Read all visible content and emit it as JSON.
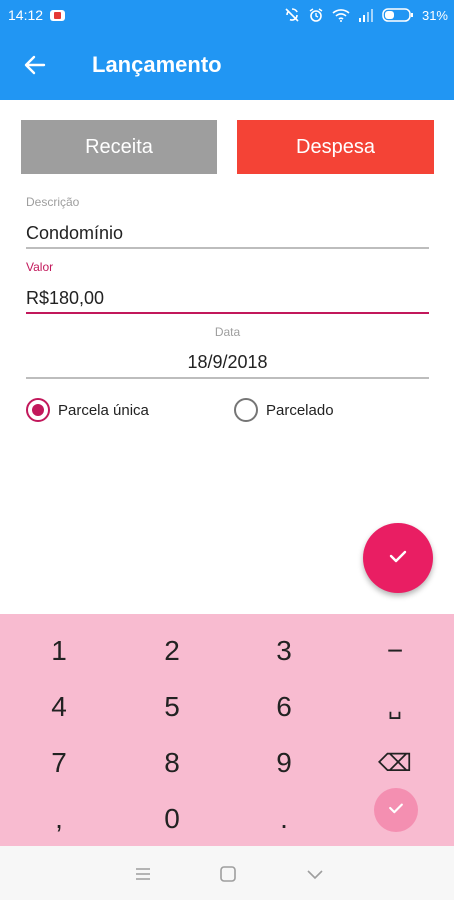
{
  "status_bar": {
    "time": "14:12",
    "battery": "31%"
  },
  "app_bar": {
    "title": "Lançamento"
  },
  "type_buttons": {
    "receita": "Receita",
    "despesa": "Despesa"
  },
  "form": {
    "descricao_label": "Descrição",
    "descricao_value": "Condomínio",
    "valor_label": "Valor",
    "valor_value": "R$180,00",
    "data_label": "Data",
    "data_value": "18/9/2018"
  },
  "radio": {
    "unica_label": "Parcela única",
    "parcelado_label": "Parcelado",
    "selected": "Parcela única"
  },
  "keypad": {
    "row1": [
      "1",
      "2",
      "3",
      "−"
    ],
    "row2": [
      "4",
      "5",
      "6",
      "␣"
    ],
    "row3": [
      "7",
      "8",
      "9",
      "⌫"
    ],
    "row4": [
      ",",
      "0",
      "."
    ]
  },
  "colors": {
    "primary": "#2196f3",
    "accent": "#e91e63",
    "despesa": "#f44336",
    "receita": "#9e9e9e",
    "keypad_bg": "#f8bbd0"
  }
}
